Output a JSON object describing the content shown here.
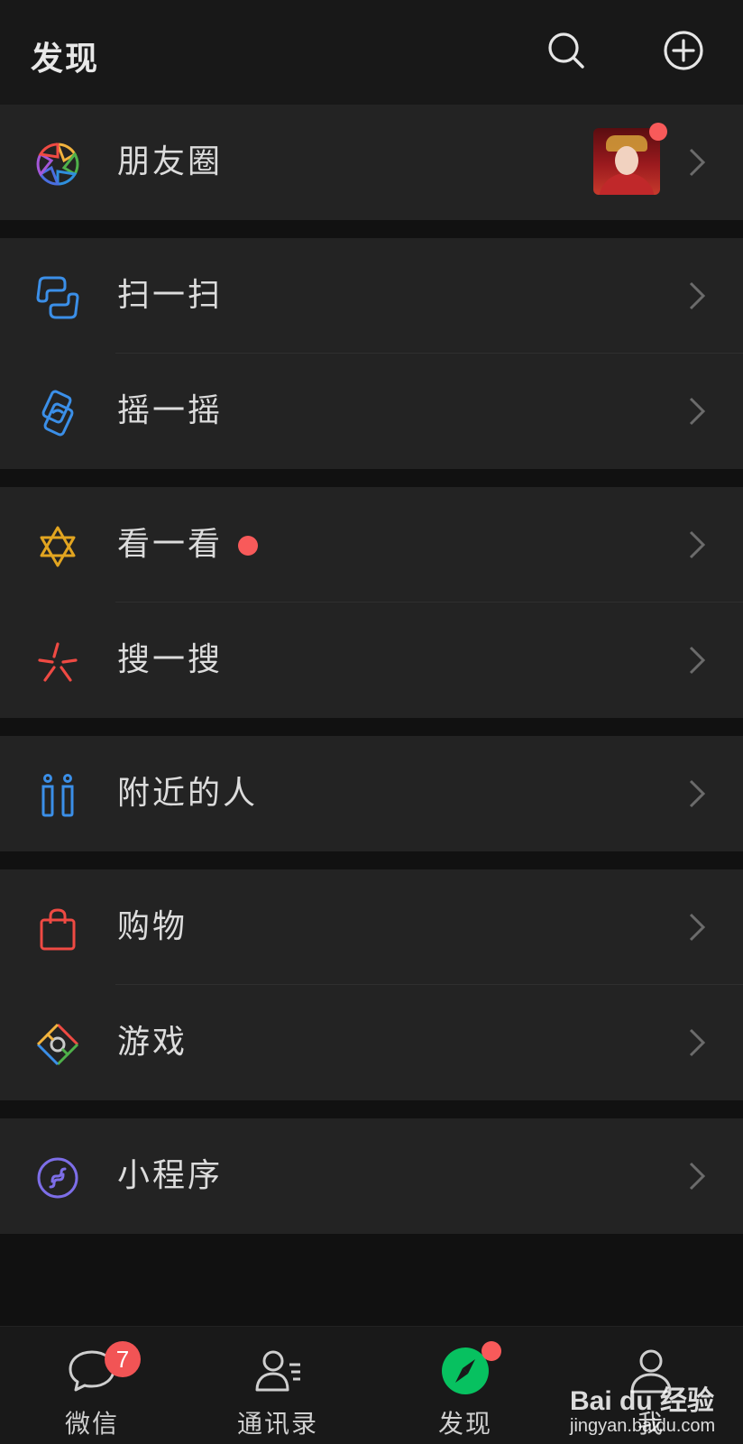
{
  "header": {
    "title": "发现",
    "search_icon": "search-icon",
    "add_icon": "plus-circle-icon"
  },
  "groups": [
    {
      "items": [
        {
          "label": "朋友圈",
          "icon": "moments-aperture-icon",
          "has_thumbnail": true,
          "has_dot": true
        }
      ]
    },
    {
      "items": [
        {
          "label": "扫一扫",
          "icon": "scan-icon"
        },
        {
          "label": "摇一摇",
          "icon": "shake-icon"
        }
      ]
    },
    {
      "items": [
        {
          "label": "看一看",
          "icon": "top-stories-icon",
          "has_dot": true
        },
        {
          "label": "搜一搜",
          "icon": "search-sparkle-icon"
        }
      ]
    },
    {
      "items": [
        {
          "label": "附近的人",
          "icon": "people-nearby-icon"
        }
      ]
    },
    {
      "items": [
        {
          "label": "购物",
          "icon": "shopping-bag-icon"
        },
        {
          "label": "游戏",
          "icon": "games-icon"
        }
      ]
    },
    {
      "items": [
        {
          "label": "小程序",
          "icon": "mini-program-icon"
        }
      ]
    }
  ],
  "tabbar": {
    "tabs": [
      {
        "label": "微信",
        "icon": "chat-bubble-icon",
        "badge": "7"
      },
      {
        "label": "通讯录",
        "icon": "contacts-icon"
      },
      {
        "label": "发现",
        "icon": "compass-icon",
        "active": true,
        "has_dot": true
      },
      {
        "label": "我",
        "icon": "me-person-icon"
      }
    ]
  },
  "watermark": {
    "main": "Bai du 经验",
    "sub": "jingyan.baidu.com"
  },
  "colors": {
    "background": "#111111",
    "header": "#181818",
    "cell": "#232323",
    "accent_green": "#07c160",
    "badge_red": "#f25455",
    "dot_red": "#f85a5a"
  }
}
